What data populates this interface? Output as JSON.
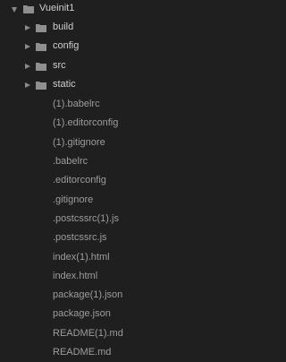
{
  "tree": {
    "root": {
      "name": "Vueinit1",
      "expanded": true,
      "icon": "folder-icon"
    },
    "folders": [
      {
        "name": "build",
        "expanded": false,
        "icon": "folder-icon"
      },
      {
        "name": "config",
        "expanded": false,
        "icon": "folder-icon"
      },
      {
        "name": "src",
        "expanded": false,
        "icon": "folder-icon"
      },
      {
        "name": "static",
        "expanded": false,
        "icon": "folder-icon"
      }
    ],
    "files": [
      "(1).babelrc",
      "(1).editorconfig",
      "(1).gitignore",
      ".babelrc",
      ".editorconfig",
      ".gitignore",
      ".postcssrc(1).js",
      ".postcssrc.js",
      "index(1).html",
      "index.html",
      "package(1).json",
      "package.json",
      "README(1).md",
      "README.md"
    ]
  },
  "colors": {
    "background": "#1f1f1f",
    "folder_text": "#cfcfcf",
    "file_text": "#9d9d9d",
    "icon": "#8f8f8f"
  }
}
